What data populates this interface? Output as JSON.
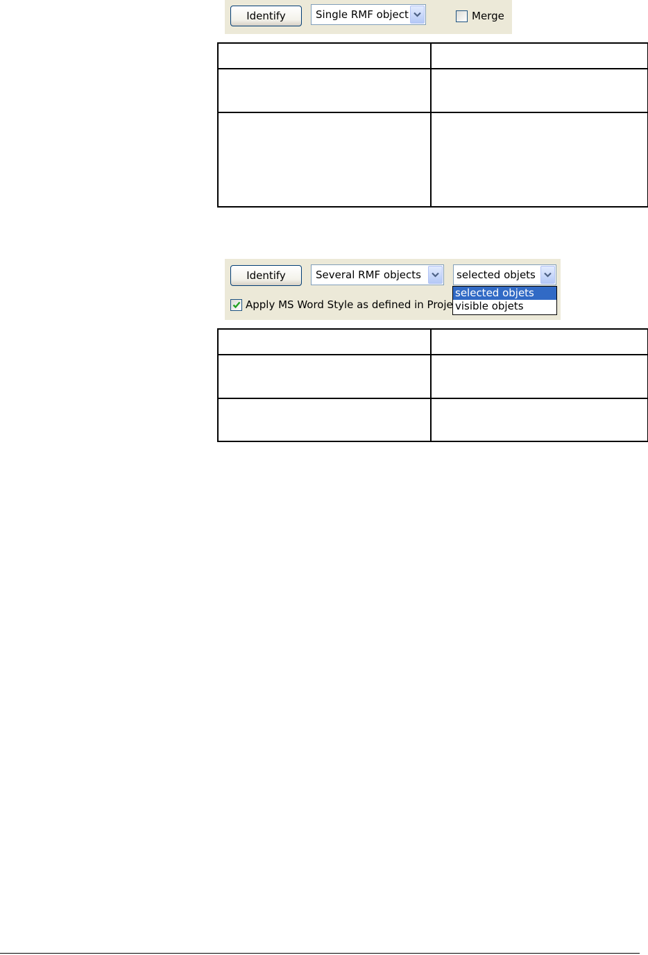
{
  "toolbar1": {
    "identify_label": "Identify",
    "mode_select_value": "Single RMF object",
    "merge_label": "Merge",
    "merge_checked": false
  },
  "table1": {
    "rows": [
      [
        "",
        ""
      ],
      [
        "",
        ""
      ],
      [
        "",
        ""
      ]
    ]
  },
  "toolbar2": {
    "identify_label": "Identify",
    "mode_select_value": "Several RMF objects",
    "scope_select_value": "selected objets",
    "scope_options": [
      "selected objets",
      "visible objets"
    ],
    "scope_highlighted": "selected objets",
    "apply_style_label": "Apply MS Word Style as defined in Project",
    "apply_style_checked": true
  },
  "table2": {
    "rows": [
      [
        "",
        ""
      ],
      [
        "",
        ""
      ],
      [
        "",
        ""
      ]
    ]
  },
  "colors": {
    "toolbar_bg": "#ece9d8",
    "highlight": "#316ac5",
    "check_mark": "#21a121"
  },
  "icons": [
    "chevron-down-icon",
    "checkmark-icon"
  ]
}
